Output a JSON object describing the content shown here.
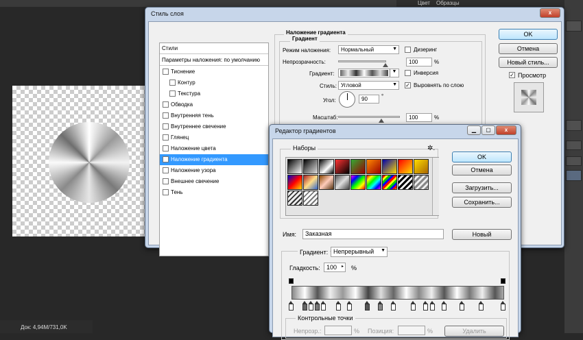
{
  "ps": {
    "panel_tabs": [
      "Цвет",
      "Образцы"
    ],
    "status": "Док: 4,94M/731,0K"
  },
  "layer_style": {
    "title": "Стиль слоя",
    "close": "x",
    "list": [
      {
        "label": "Стили",
        "type": "header"
      },
      {
        "label": "Параметры наложения: по умолчанию",
        "type": "header"
      },
      {
        "label": "Тиснение",
        "checked": false
      },
      {
        "label": "Контур",
        "checked": false,
        "indent": true
      },
      {
        "label": "Текстура",
        "checked": false,
        "indent": true
      },
      {
        "label": "Обводка",
        "checked": false
      },
      {
        "label": "Внутренняя тень",
        "checked": false
      },
      {
        "label": "Внутреннее свечение",
        "checked": false
      },
      {
        "label": "Глянец",
        "checked": false
      },
      {
        "label": "Наложение цвета",
        "checked": false
      },
      {
        "label": "Наложение градиента",
        "checked": true,
        "selected": true
      },
      {
        "label": "Наложение узора",
        "checked": false
      },
      {
        "label": "Внешнее свечение",
        "checked": false
      },
      {
        "label": "Тень",
        "checked": false
      }
    ],
    "section_title": "Наложение градиента",
    "subsection_title": "Градиент",
    "blend_mode_label": "Режим наложения:",
    "blend_mode_value": "Нормальный",
    "dither_label": "Дизеринг",
    "opacity_label": "Непрозрачность:",
    "opacity_value": "100",
    "opacity_unit": "%",
    "opacity_level": 1.0,
    "gradient_label": "Градиент:",
    "reverse_label": "Инверсия",
    "style_label": "Стиль:",
    "style_value": "Угловой",
    "align_label": "Выровнять по слою",
    "align_checked": "✓",
    "angle_label": "Угол:",
    "angle_value": "90",
    "angle_unit": "°",
    "scale_label": "Масштаб:",
    "scale_value": "100",
    "scale_unit": "%",
    "scale_level": 0.7,
    "ok": "OK",
    "cancel": "Отмена",
    "new_style": "Новый стиль...",
    "preview_label": "Просмотр",
    "preview_checked": "✓"
  },
  "gradient_editor": {
    "title": "Редактор градиентов",
    "presets_label": "Наборы",
    "gear": "✲.",
    "ok": "OK",
    "cancel": "Отмена",
    "load": "Загрузить...",
    "save": "Сохранить...",
    "name_label": "Имя:",
    "name_value": "Заказная",
    "new": "Новый",
    "type_label": "Градиент:",
    "type_value": "Непрерывный",
    "smoothness_label": "Гладкость:",
    "smoothness_value": "100",
    "smoothness_unit": "%",
    "stops_group": "Контрольные точки",
    "opacity_label": "Непрозр.:",
    "opacity_unit": "%",
    "position_label": "Позиция:",
    "position_unit": "%",
    "delete": "Удалить"
  }
}
